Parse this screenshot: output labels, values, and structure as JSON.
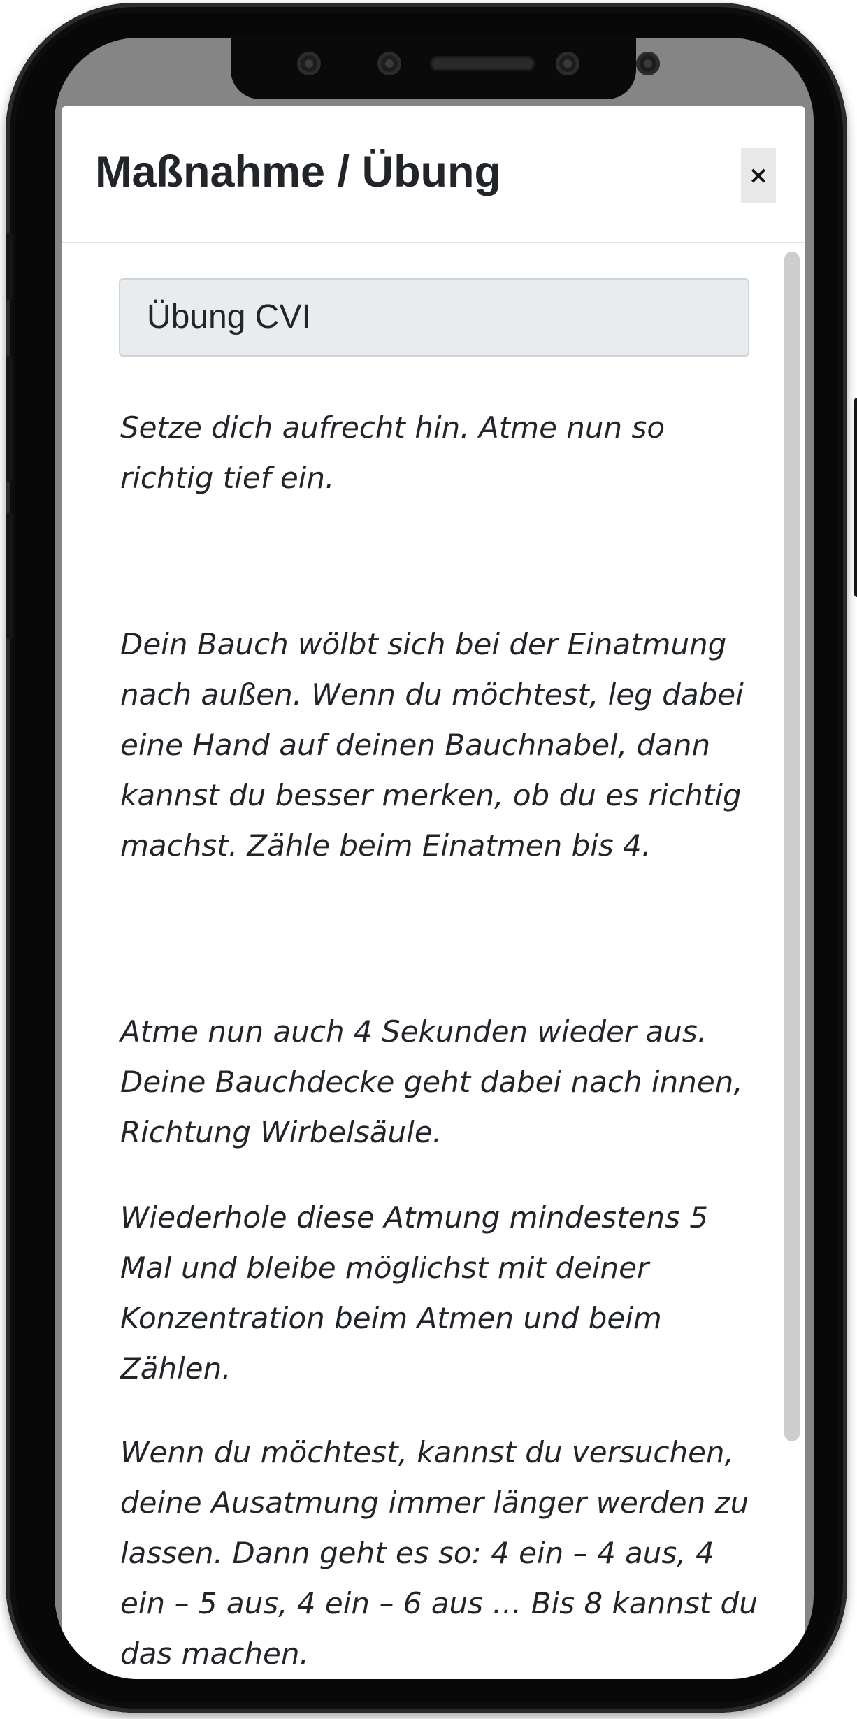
{
  "modal": {
    "title": "Maßnahme / Übung",
    "close_label": "×",
    "exercise_name": "Übung CVI",
    "paragraphs": [
      "Setze dich aufrecht hin. Atme nun so richtig tief ein.",
      "Dein Bauch wölbt sich bei der Einatmung nach außen. Wenn du möchtest, leg dabei eine Hand auf deinen Bauchnabel, dann kannst du besser merken, ob du es richtig machst. Zähle beim Einatmen bis 4.",
      "Atme nun auch 4 Sekunden wieder aus. Deine Bauchdecke geht dabei nach innen, Richtung Wirbelsäule.",
      "Wiederhole diese Atmung mindestens 5 Mal und bleibe möglichst mit deiner Konzentration beim Atmen und beim Zählen.",
      "Wenn du möchtest, kannst du versuchen, deine Ausatmung immer länger werden zu lassen. Dann geht es so: 4 ein – 4 aus, 4 ein – 5 aus, 4 ein – 6 aus … Bis 8 kannst du das machen."
    ]
  },
  "icons": {
    "close": "close-icon"
  },
  "colors": {
    "text": "#212529",
    "field_background": "#e9ecef",
    "overlay": "#858585",
    "device_frame": "#080808"
  }
}
